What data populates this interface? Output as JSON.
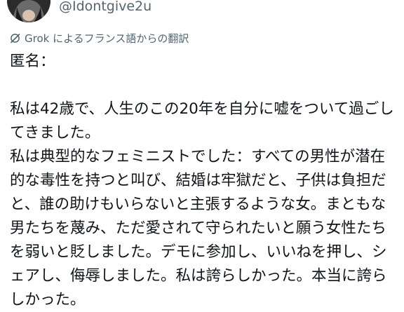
{
  "header": {
    "handle": "@Idontgive2u"
  },
  "translation": {
    "icon": "grok-icon",
    "label": "Grok によるフランス語からの翻訳"
  },
  "tweet": {
    "lines": [
      "匿名：",
      "",
      "私は42歳で、人生のこの20年を自分に嘘をついて過ごし",
      "てきました。",
      "私は典型的なフェミニストでした：すべての男性が潜在",
      "的な毒性を持つと叫び、結婚は牢獄だと、子供は負担だ",
      "と、誰の助けもいらないと主張するような女。まともな",
      "男たちを蔑み、ただ愛されて守られたいと願う女性たち",
      "を弱いと貶しました。デモに参加し、いいねを押し、シ",
      "ェアし、侮辱しました。私は誇らしかった。本当に誇ら",
      "しかった。"
    ]
  }
}
